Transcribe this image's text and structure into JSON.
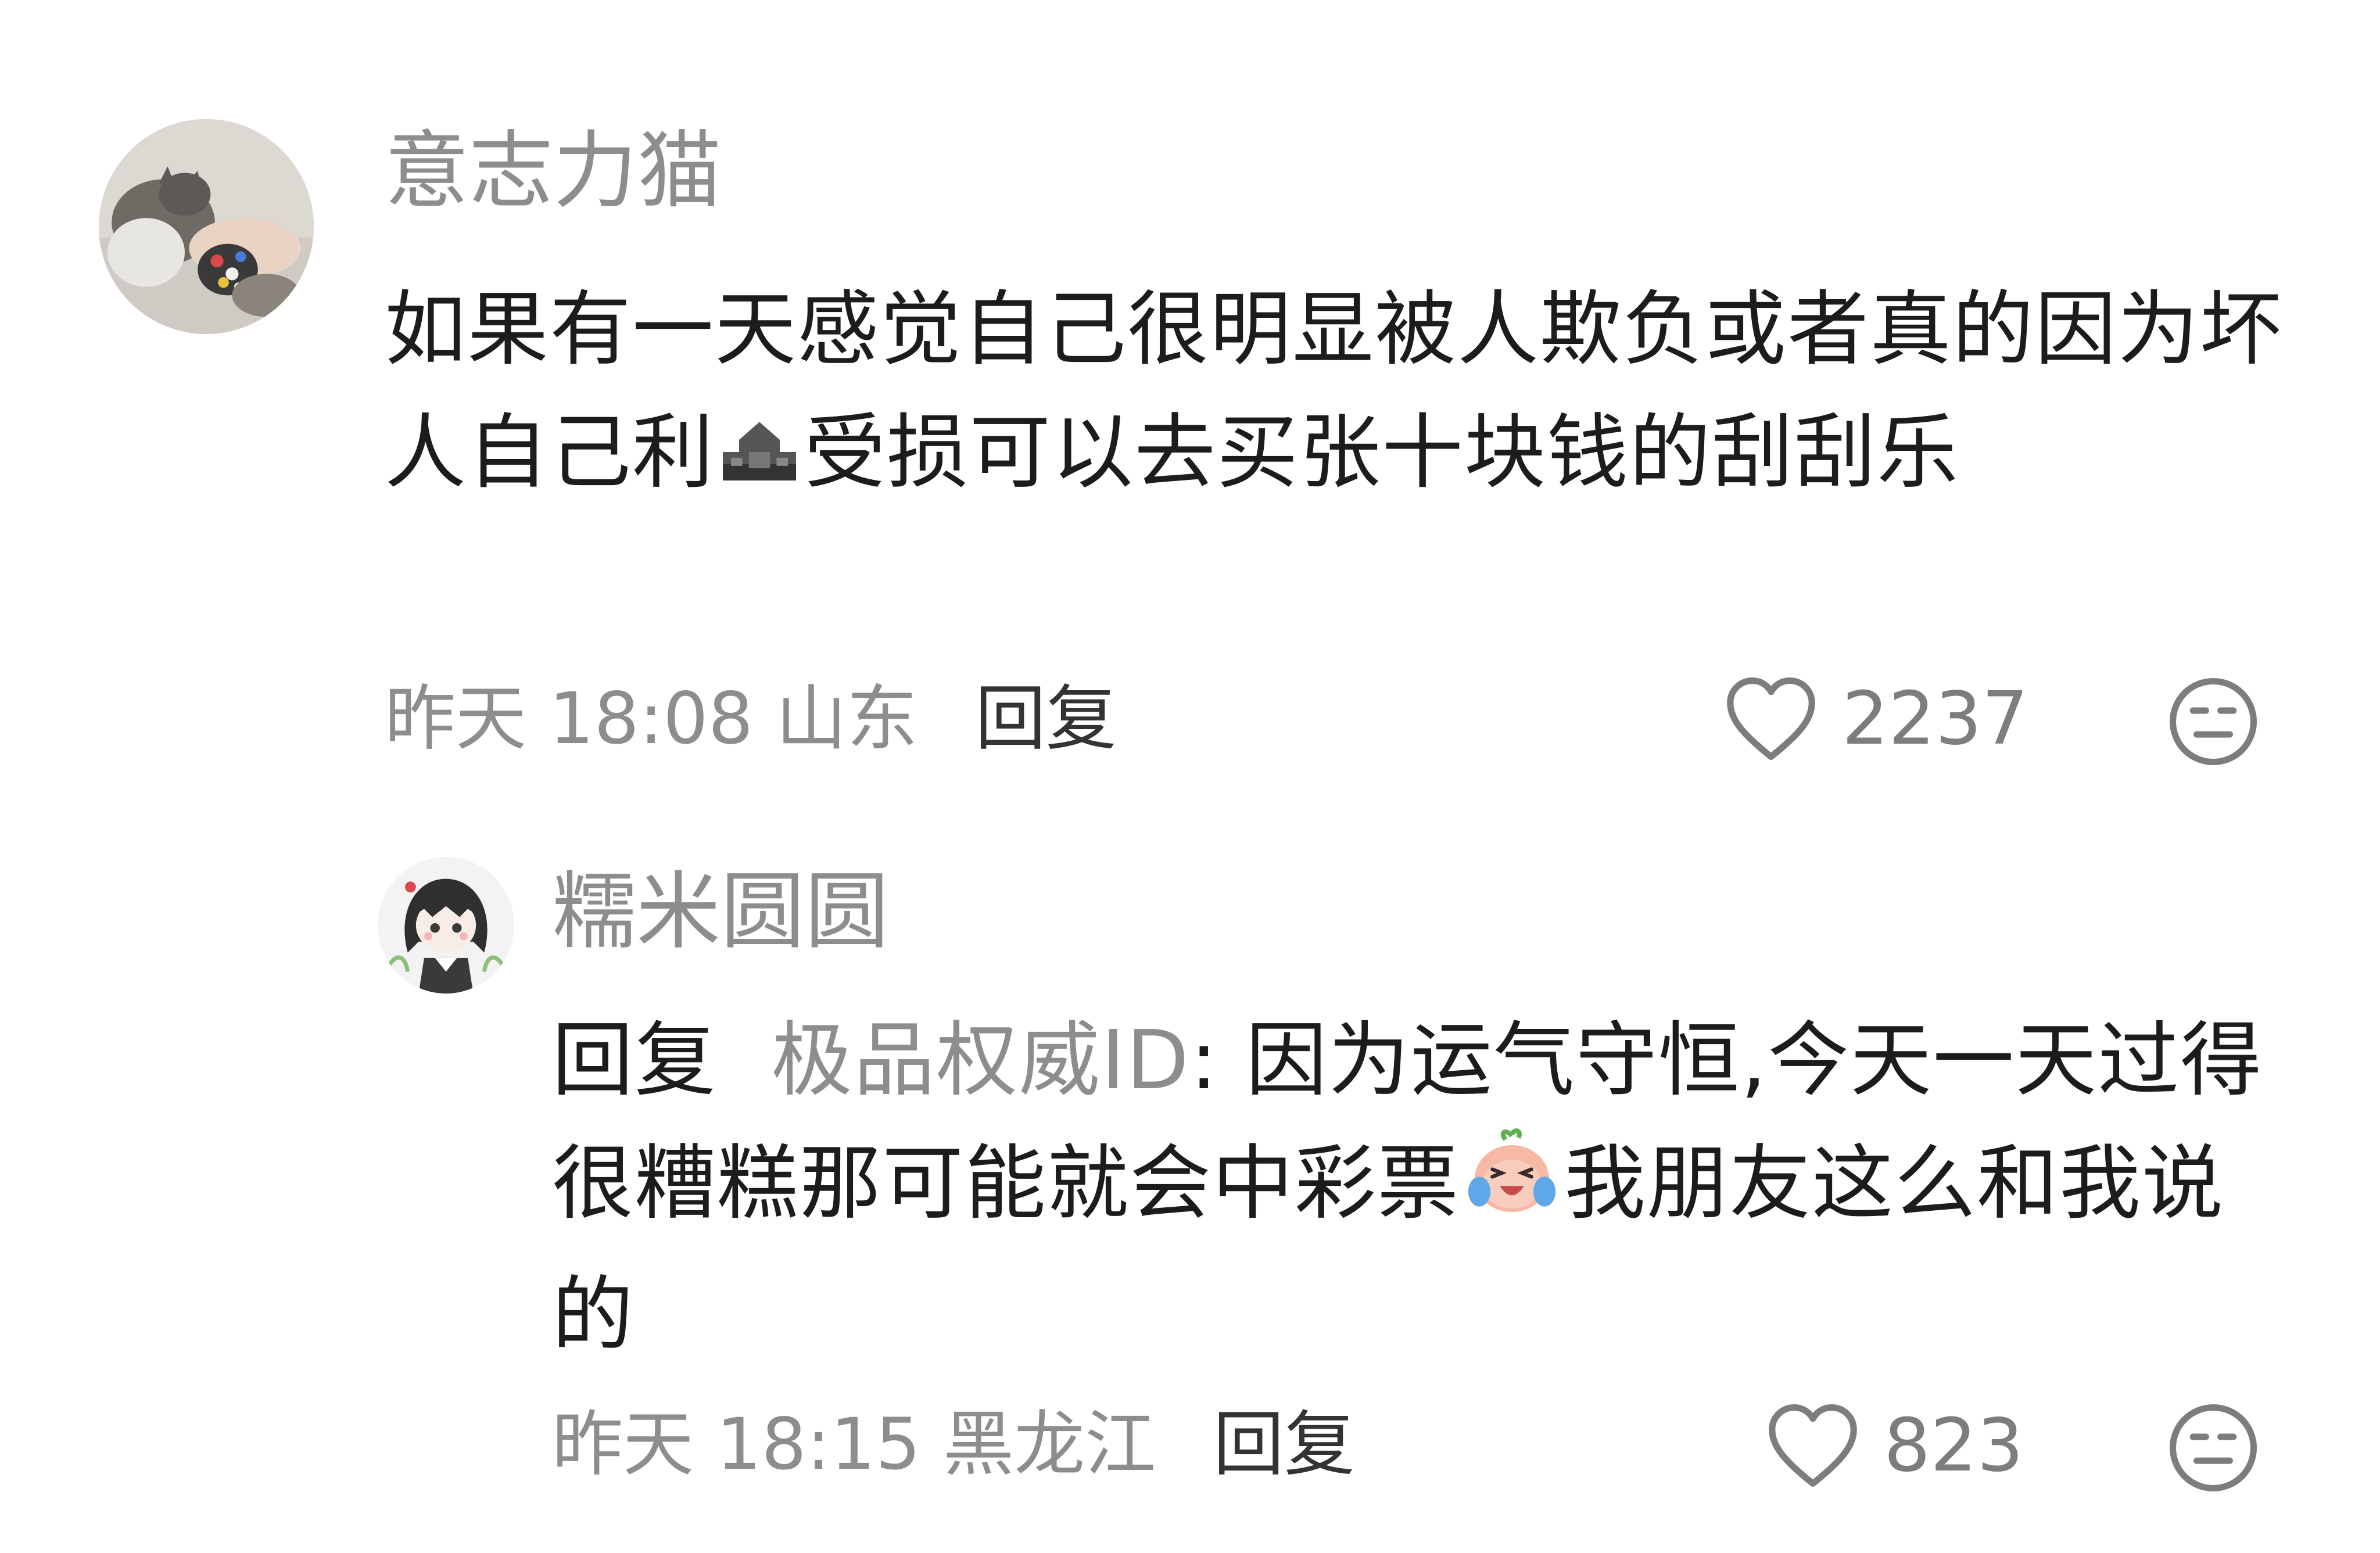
{
  "comments": [
    {
      "username": "意志力猫",
      "text_part1": "如果有一天感觉自己很明显被人欺负或者真的因为坏人自己利",
      "text_part2": "受损可以去买张十块钱的刮刮乐",
      "time": "昨天 18:08",
      "location": "山东",
      "reply_label": "回复",
      "like_count": "2237",
      "avatar_icon": "cat-photo-avatar",
      "inline_icon": "censored-emoji-icon"
    },
    {
      "username": "糯米圆圆",
      "reply_prefix": "回复",
      "mention": "极品权威ID",
      "colon": ":",
      "text_part1": " 因为运气守恒,今天一天过得很糟糕那可能就会中彩票",
      "text_part2": "我朋友这么和我说的",
      "time": "昨天 18:15",
      "location": "黑龙江",
      "reply_label": "回复",
      "like_count": "823",
      "avatar_icon": "anime-girl-avatar",
      "inline_icon": "crying-laughing-emoji-icon"
    }
  ],
  "colors": {
    "muted_text": "#8d8d8d",
    "body_text": "#1c1c1c",
    "icon_stroke": "#7d7d7d"
  }
}
